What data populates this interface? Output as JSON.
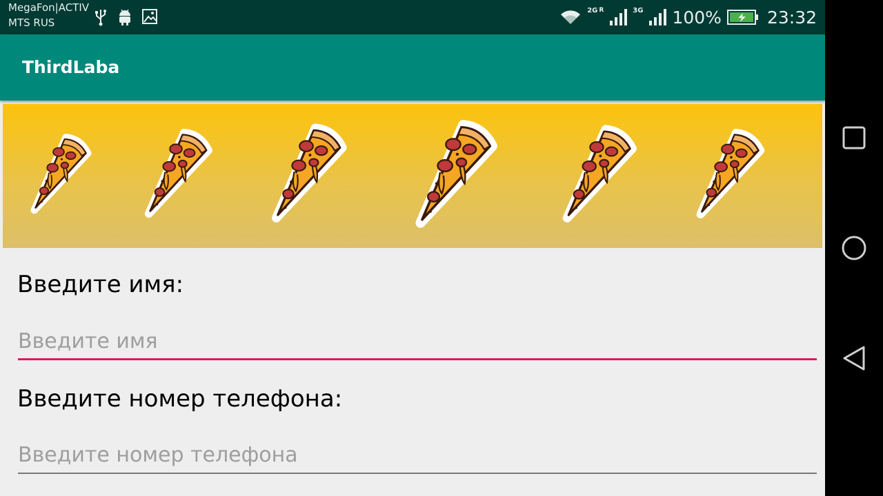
{
  "status_bar": {
    "carrier_line1": "MegaFon|ACTIV",
    "carrier_line2": "MTS RUS",
    "left_icons": [
      "usb-icon",
      "android-icon",
      "image-icon"
    ],
    "network1_label": "2G",
    "network1_roaming": "R",
    "network2_label": "3G",
    "battery_percent": "100%",
    "time": "23:32"
  },
  "app_bar": {
    "title": "ThirdLaba"
  },
  "banner": {
    "pizza_count": 6,
    "icon": "pizza-slice-icon"
  },
  "form": {
    "name_label": "Введите имя:",
    "name_placeholder": "Введите имя",
    "name_value": "",
    "phone_label": "Введите номер телефона:",
    "phone_placeholder": "Введите номер телефона",
    "phone_value": ""
  },
  "nav_bar": {
    "buttons": [
      "recents-icon",
      "home-icon",
      "back-icon"
    ]
  },
  "colors": {
    "app_bar": "#00897b",
    "status_bar": "#013a33",
    "accent": "#d81b60",
    "banner_top": "#fcc30c",
    "banner_bottom": "#dcc06a"
  }
}
